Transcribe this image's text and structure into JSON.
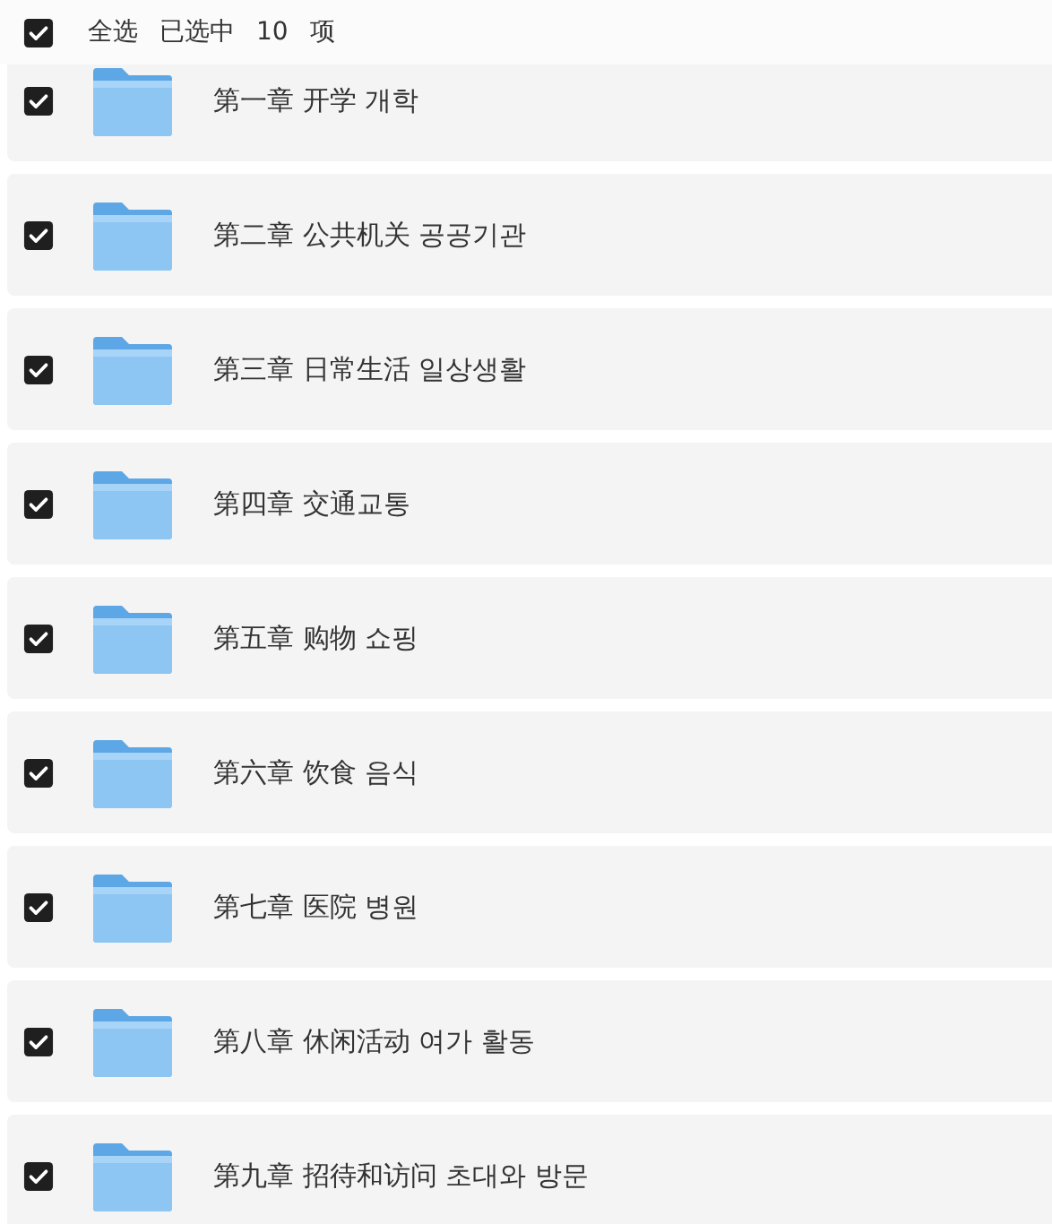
{
  "select_all": {
    "checked": true,
    "label": "全选",
    "selected_text": "已选中",
    "count": "10",
    "unit": "项"
  },
  "folders": [
    {
      "name": "第一章 开学  개학",
      "checked": true
    },
    {
      "name": "第二章 公共机关  공공기관",
      "checked": true
    },
    {
      "name": "第三章 日常生活  일상생활",
      "checked": true
    },
    {
      "name": "第四章 交通교통",
      "checked": true
    },
    {
      "name": "第五章 购物  쇼핑",
      "checked": true
    },
    {
      "name": "第六章 饮食  음식",
      "checked": true
    },
    {
      "name": "第七章 医院  병원",
      "checked": true
    },
    {
      "name": "第八章 休闲活动  여가 활동",
      "checked": true
    },
    {
      "name": "第九章 招待和访问  초대와 방문",
      "checked": true
    }
  ]
}
